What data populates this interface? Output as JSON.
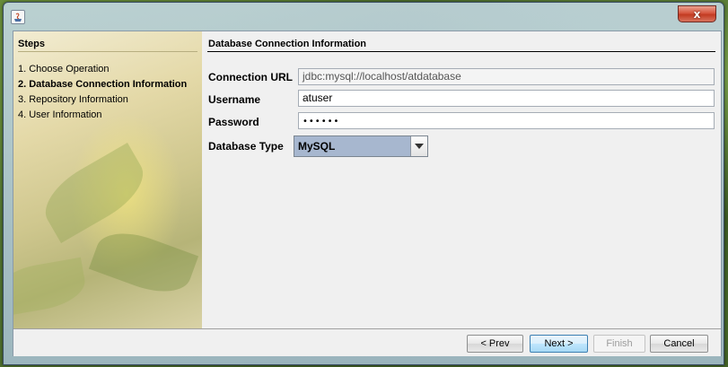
{
  "window": {
    "title": "",
    "close_label": "x"
  },
  "steps": {
    "title": "Steps",
    "items": [
      {
        "label": "1. Choose Operation",
        "active": false
      },
      {
        "label": "2. Database Connection Information",
        "active": true
      },
      {
        "label": "3. Repository Information",
        "active": false
      },
      {
        "label": "4. User Information",
        "active": false
      }
    ]
  },
  "content": {
    "title": "Database Connection Information",
    "fields": {
      "connection_url": {
        "label": "Connection URL",
        "value": "jdbc:mysql://localhost/atdatabase"
      },
      "username": {
        "label": "Username",
        "value": "atuser"
      },
      "password": {
        "label": "Password",
        "value": "••••••"
      },
      "database_type": {
        "label": "Database Type",
        "selected": "MySQL"
      }
    }
  },
  "buttons": {
    "prev": "< Prev",
    "next": "Next >",
    "finish": "Finish",
    "cancel": "Cancel"
  },
  "icons": {
    "app": "java-app-icon",
    "close": "close-icon",
    "dropdown": "chevron-down-icon"
  },
  "colors": {
    "combo_selected_bg": "#a7b7cf",
    "close_button": "#c23b22"
  }
}
